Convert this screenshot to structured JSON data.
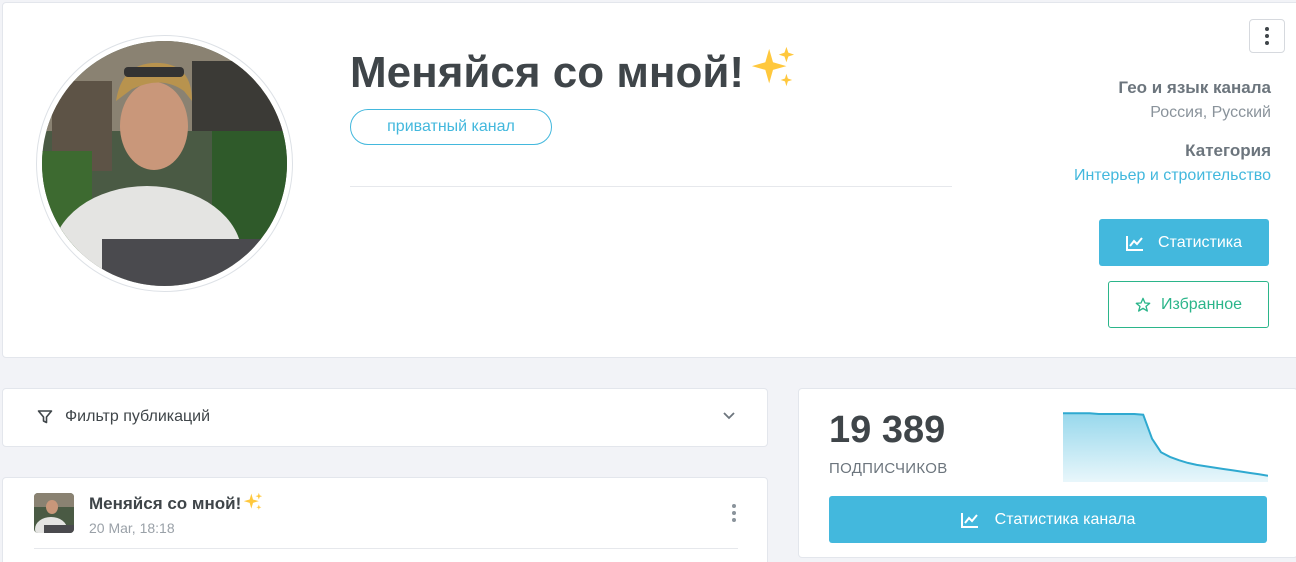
{
  "channel": {
    "title": "Меняйся со мной!",
    "badge": "приватный канал",
    "geo_label": "Гео и язык канала",
    "geo_value": "Россия, Русский",
    "category_label": "Категория",
    "category_value": "Интерьер и строительство",
    "stats_button": "Статистика",
    "favorite_button": "Избранное"
  },
  "filter": {
    "label": "Фильтр публикаций"
  },
  "post": {
    "title": "Меняйся со мной!",
    "date": "20 Mar, 18:18"
  },
  "subscribers": {
    "count": "19 389",
    "label": "ПОДПИСЧИКОВ",
    "button": "Статистика канала",
    "trend": [
      0.98,
      0.98,
      0.98,
      0.98,
      0.97,
      0.97,
      0.97,
      0.97,
      0.97,
      0.96,
      0.6,
      0.4,
      0.33,
      0.28,
      0.24,
      0.21,
      0.19,
      0.17,
      0.15,
      0.13,
      0.11,
      0.09,
      0.07,
      0.05
    ]
  },
  "colors": {
    "accent": "#43b8dd",
    "favorite": "#2bb58a",
    "text_dark": "#3f4549"
  }
}
